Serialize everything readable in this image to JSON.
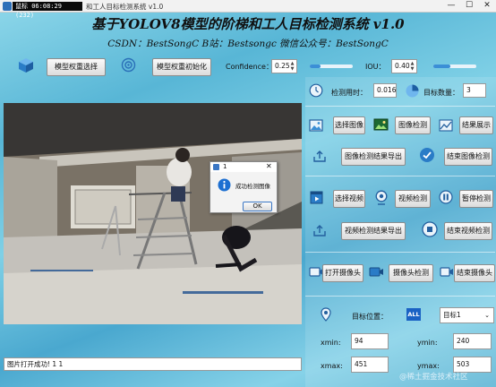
{
  "window": {
    "stamp": "鼠标  06:08:29 (232)",
    "title": "和工人目标检测系统 v1.0",
    "minimize": "—",
    "maximize": "☐",
    "close": "✕"
  },
  "header": {
    "title": "基于YOLOV8模型的阶梯和工人目标检测系统 v1.0",
    "subtitle": "CSDN：BestSongC   B站：Bestsongc   微信公众号：BestSongC"
  },
  "toolbar": {
    "model_select": "模型权重选择",
    "model_init": "模型权重初始化",
    "confidence_label": "Confidence：",
    "confidence_value": "0.25",
    "confidence_level": 0.25,
    "iou_label": "IOU：",
    "iou_value": "0.40",
    "iou_level": 0.4
  },
  "stats": {
    "time_label": "检测用时：",
    "time_value": "0.016",
    "count_label": "目标数量：",
    "count_value": "3"
  },
  "image_controls": {
    "select": "选择图像",
    "detect": "图像检测",
    "show": "结果展示",
    "export": "图像检测结果导出",
    "stop": "结束图像检测"
  },
  "video_controls": {
    "select": "选择视频",
    "detect": "视频检测",
    "pause": "暂停检测",
    "export": "视频检测结果导出",
    "stop": "结束视频检测"
  },
  "camera_controls": {
    "open": "打开摄像头",
    "detect": "摄像头检测",
    "stop": "结束摄像头"
  },
  "target": {
    "label": "目标位置：",
    "badge": "ALL",
    "selected": "目标1",
    "xmin_label": "xmin:",
    "xmin": "94",
    "ymin_label": "ymin:",
    "ymin": "240",
    "xmax_label": "xmax:",
    "xmax": "451",
    "ymax_label": "ymax:",
    "ymax": "503"
  },
  "dialog": {
    "title": "1",
    "message": "成功检测图像",
    "ok": "OK",
    "close": "✕"
  },
  "status": {
    "text": "图片打开成功! 1 1"
  },
  "watermark": "@稀土掘金技术社区",
  "colors": {
    "accent": "#3b8fd6",
    "info": "#1d6fd1"
  }
}
